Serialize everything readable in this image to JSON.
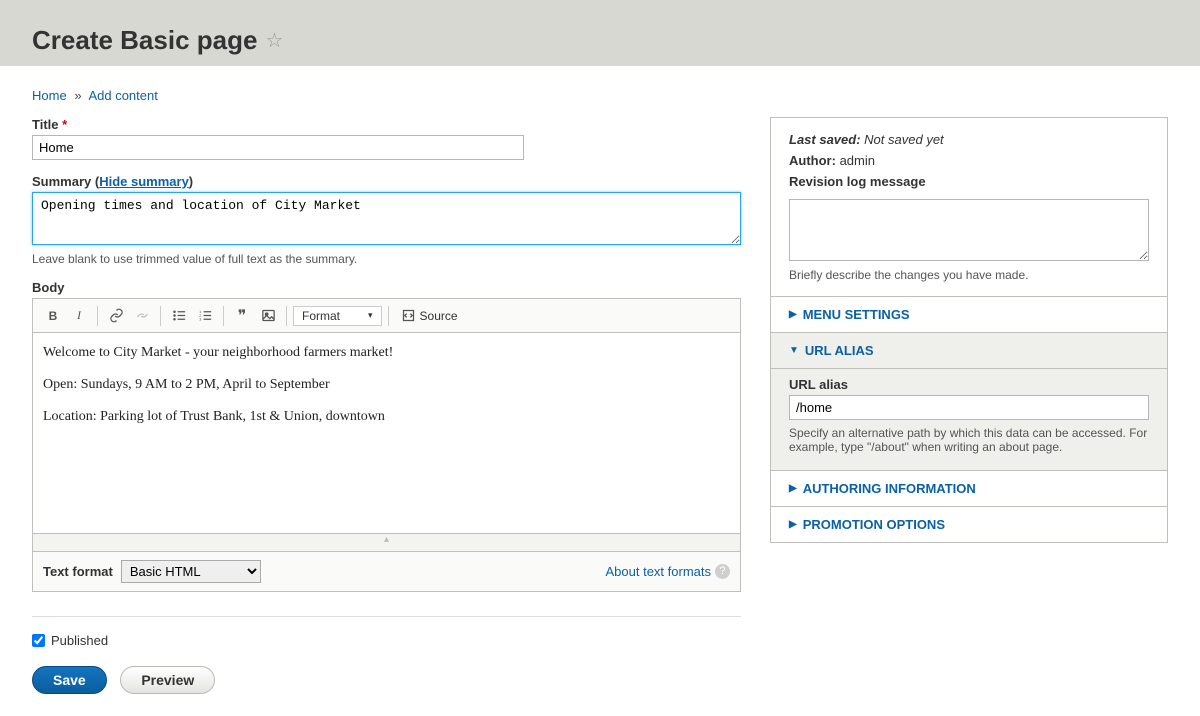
{
  "header": {
    "page_title": "Create Basic page"
  },
  "breadcrumb": {
    "home": "Home",
    "add_content": "Add content"
  },
  "fields": {
    "title_label": "Title",
    "title_value": "Home",
    "summary_label_prefix": "Summary (",
    "summary_hide_link": "Hide summary",
    "summary_label_suffix": ")",
    "summary_value": "Opening times and location of City Market",
    "summary_help": "Leave blank to use trimmed value of full text as the summary.",
    "body_label": "Body",
    "body_p1": "Welcome to City Market - your neighborhood farmers market!",
    "body_p2": "Open: Sundays, 9 AM to 2 PM, April to September",
    "body_p3": "Location: Parking lot of Trust Bank, 1st & Union, downtown",
    "text_format_label": "Text format",
    "text_format_value": "Basic HTML",
    "about_text_formats": "About text formats"
  },
  "editor_toolbar": {
    "format_label": "Format",
    "source_label": "Source"
  },
  "published_label": "Published",
  "buttons": {
    "save": "Save",
    "preview": "Preview"
  },
  "sidebar": {
    "last_saved_label": "Last saved:",
    "last_saved_value": "Not saved yet",
    "author_label": "Author:",
    "author_value": "admin",
    "revision_label": "Revision log message",
    "revision_help": "Briefly describe the changes you have made.",
    "menu_settings": "MENU SETTINGS",
    "url_alias_header": "URL ALIAS",
    "url_alias_label": "URL alias",
    "url_alias_value": "/home",
    "url_alias_help": "Specify an alternative path by which this data can be accessed. For example, type \"/about\" when writing an about page.",
    "authoring": "AUTHORING INFORMATION",
    "promotion": "PROMOTION OPTIONS"
  }
}
